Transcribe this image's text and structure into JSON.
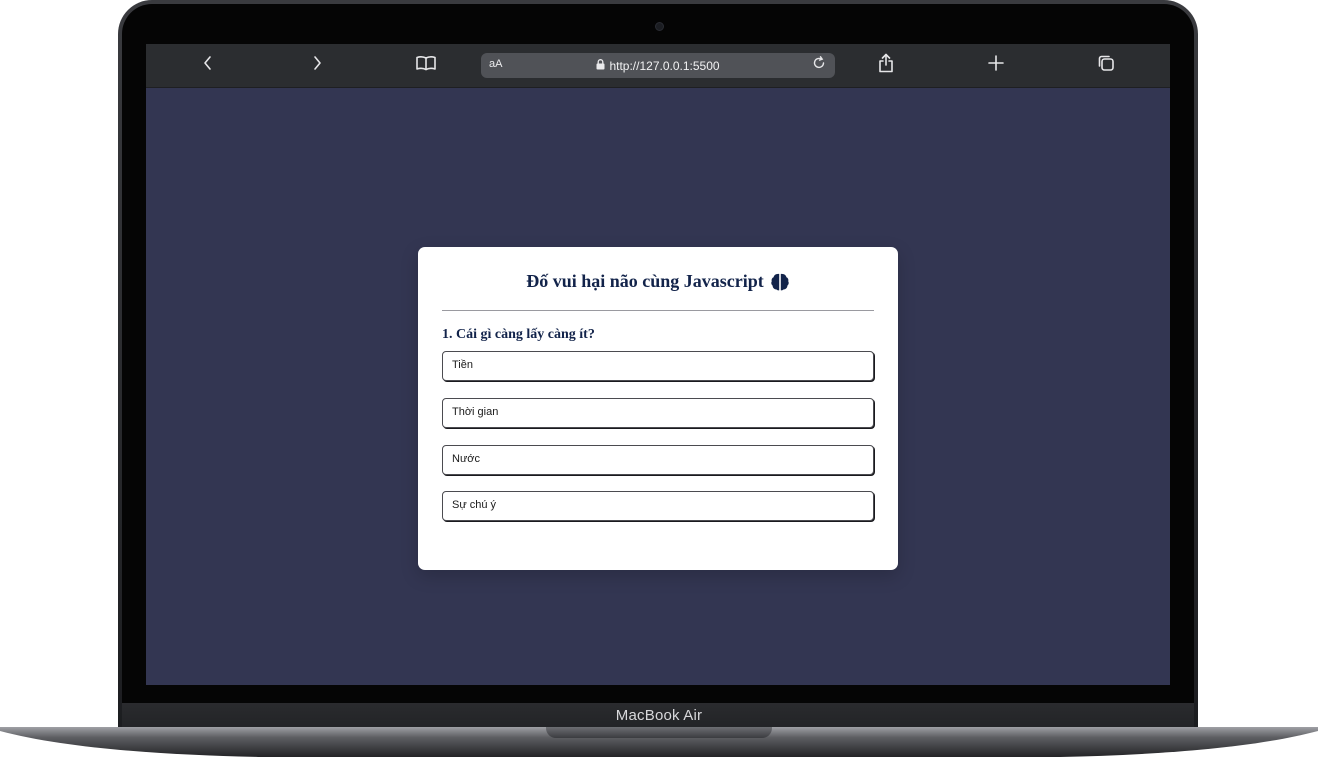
{
  "device": {
    "label": "MacBook Air"
  },
  "browser": {
    "address_bar": {
      "text_size_label": "aA",
      "url": "http://127.0.0.1:5500"
    },
    "icons": [
      "chevron-left-icon",
      "chevron-right-icon",
      "book-icon",
      "lock-icon",
      "reload-icon",
      "share-icon",
      "plus-icon",
      "tabs-icon"
    ]
  },
  "page": {
    "background": "#333652"
  },
  "quiz": {
    "title": "Đố vui hại não cùng Javascript",
    "title_icon": "brain-icon",
    "question": "1. Cái gì càng lấy càng ít?",
    "options": [
      "Tiền",
      "Thời gian",
      "Nước",
      "Sự chú ý"
    ]
  },
  "colors": {
    "title": "#12234a",
    "card": "#ffffff"
  }
}
